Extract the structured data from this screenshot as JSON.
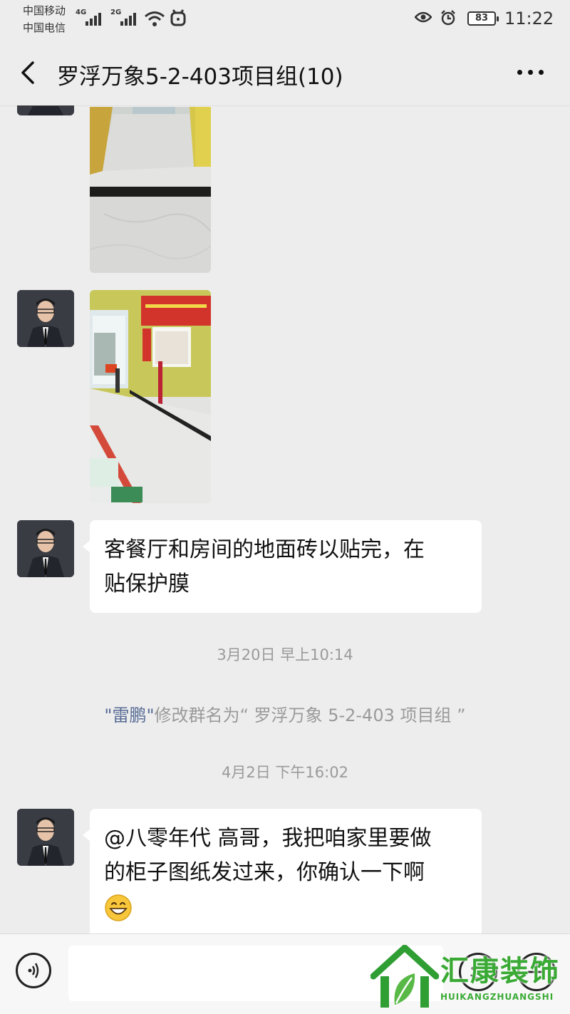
{
  "status_bar": {
    "carrier_1": "中国移动",
    "carrier_2": "中国电信",
    "net_1": "4G",
    "net_2": "2G",
    "battery": "83",
    "time": "11:22"
  },
  "header": {
    "title": "罗浮万象5-2-403项目组(10)"
  },
  "messages": {
    "text_1": {
      "line_1": "客餐厅和房间的地面砖以贴完，在",
      "line_2": "贴保护膜"
    },
    "timestamp_1": "3月20日 早上10:14",
    "system_1": {
      "name": "\"雷鹏\"",
      "rest": "修改群名为“ 罗浮万象 5-2-403 项目组 ”"
    },
    "timestamp_2": "4月2日 下午16:02",
    "text_2": {
      "line_1": "@八零年代  高哥，我把咱家里要做",
      "line_2": "的柜子图纸发过来，你确认一下啊"
    }
  },
  "watermark": {
    "brand": "汇康装饰",
    "pinyin": "HUIKANGZHUANGSHI"
  },
  "colors": {
    "background": "#ededed",
    "bubble": "#ffffff",
    "system_name": "#576b95",
    "watermark_green": "#3aaa35"
  }
}
